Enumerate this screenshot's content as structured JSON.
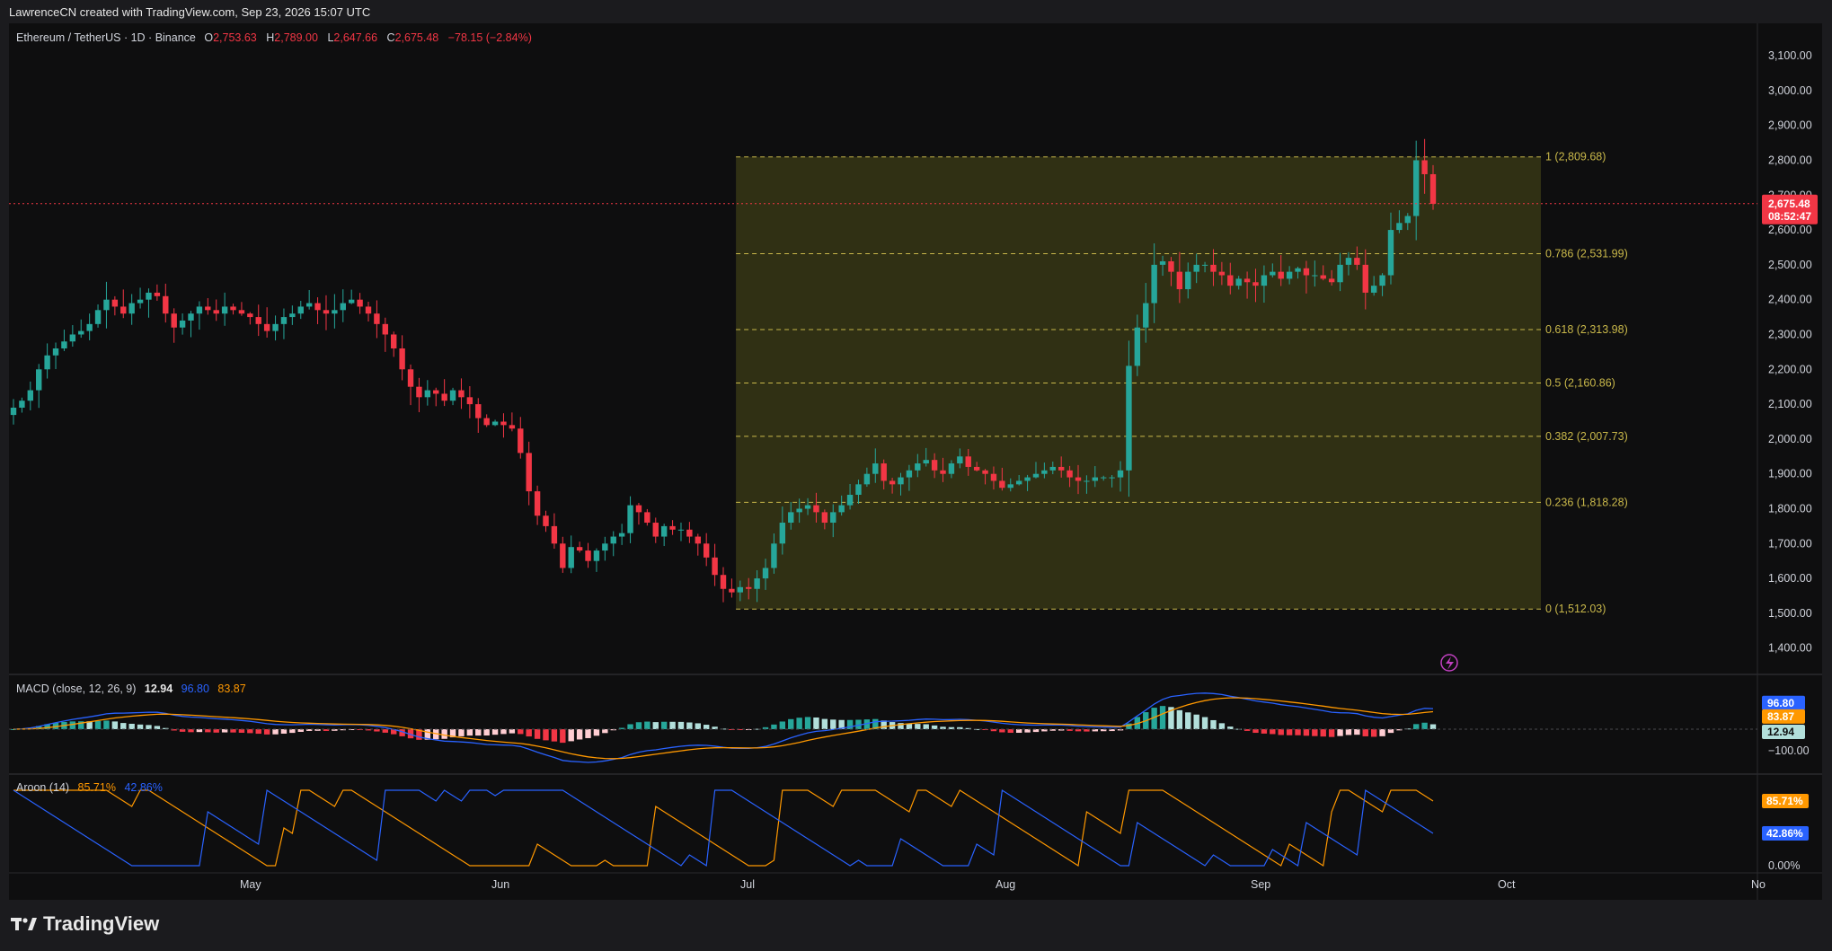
{
  "header": {
    "credit": "LawrenceCN created with TradingView.com, Sep 23, 2026 15:07 UTC"
  },
  "symbol": {
    "name": "Ethereum / TetherUS · 1D · Binance",
    "o_label": "O",
    "open": "2,753.63",
    "h_label": "H",
    "high": "2,789.00",
    "l_label": "L",
    "low": "2,647.66",
    "c_label": "C",
    "close": "2,675.48",
    "change": "−78.15 (−2.84%)"
  },
  "brand": {
    "name": "TradingView"
  },
  "colors": {
    "up": "#26a69a",
    "down": "#f23645",
    "fib": "#c9b84a",
    "macd": "#2962ff",
    "signal": "#ff9800"
  },
  "chart_data": [
    {
      "type": "candlestick",
      "title": "Ethereum / TetherUS · 1D · Binance",
      "x_ticks": [
        "May",
        "Jun",
        "Jul",
        "Aug",
        "Sep",
        "Oct",
        "No"
      ],
      "y_ticks": [
        "3,100.00",
        "3,000.00",
        "2,900.00",
        "2,800.00",
        "2,700.00",
        "2,600.00",
        "2,500.00",
        "2,400.00",
        "2,300.00",
        "2,200.00",
        "2,100.00",
        "2,000.00",
        "1,900.00",
        "1,800.00",
        "1,700.00",
        "1,600.00",
        "1,500.00",
        "1,400.00"
      ],
      "ylim": [
        1340,
        3180
      ],
      "last_price": "2,675.48",
      "countdown": "08:52:47",
      "fibonacci": {
        "levels": [
          {
            "label": "1 (2,809.68)",
            "value": 2809.68
          },
          {
            "label": "0.786 (2,531.99)",
            "value": 2531.99
          },
          {
            "label": "0.618 (2,313.98)",
            "value": 2313.98
          },
          {
            "label": "0.5 (2,160.86)",
            "value": 2160.86
          },
          {
            "label": "0.382 (2,007.73)",
            "value": 2007.73
          },
          {
            "label": "0.236 (1,818.28)",
            "value": 1818.28
          },
          {
            "label": "0 (1,512.03)",
            "value": 1512.03
          }
        ],
        "start_index": 86
      },
      "closes": [
        2090,
        2110,
        2140,
        2200,
        2240,
        2260,
        2280,
        2300,
        2310,
        2330,
        2370,
        2400,
        2380,
        2360,
        2390,
        2400,
        2420,
        2410,
        2360,
        2320,
        2340,
        2360,
        2380,
        2370,
        2360,
        2380,
        2370,
        2360,
        2350,
        2330,
        2310,
        2330,
        2350,
        2360,
        2380,
        2390,
        2370,
        2360,
        2370,
        2390,
        2400,
        2380,
        2360,
        2330,
        2300,
        2260,
        2200,
        2150,
        2120,
        2140,
        2130,
        2110,
        2140,
        2120,
        2100,
        2060,
        2040,
        2050,
        2040,
        2030,
        1960,
        1850,
        1780,
        1750,
        1700,
        1630,
        1690,
        1680,
        1650,
        1680,
        1700,
        1720,
        1730,
        1810,
        1790,
        1760,
        1720,
        1750,
        1740,
        1740,
        1720,
        1700,
        1660,
        1610,
        1570,
        1560,
        1575,
        1570,
        1600,
        1630,
        1700,
        1760,
        1790,
        1800,
        1810,
        1790,
        1760,
        1790,
        1810,
        1840,
        1870,
        1900,
        1930,
        1880,
        1870,
        1890,
        1910,
        1930,
        1940,
        1910,
        1900,
        1930,
        1950,
        1920,
        1910,
        1900,
        1880,
        1860,
        1870,
        1880,
        1890,
        1900,
        1910,
        1920,
        1910,
        1890,
        1880,
        1880,
        1890,
        1890,
        1890,
        1910,
        2210,
        2320,
        2390,
        2500,
        2510,
        2480,
        2430,
        2480,
        2500,
        2500,
        2480,
        2470,
        2440,
        2460,
        2450,
        2440,
        2470,
        2480,
        2460,
        2480,
        2490,
        2470,
        2470,
        2460,
        2450,
        2500,
        2520,
        2500,
        2420,
        2440,
        2470,
        2600,
        2620,
        2640,
        2800,
        2760,
        2675
      ],
      "volatility": 0.02
    },
    {
      "type": "line",
      "title": "MACD (close, 12, 26, 9)",
      "values_shown": [
        "12.94",
        "96.80",
        "83.87"
      ],
      "series": [
        {
          "name": "MACD",
          "color": "#2962ff"
        },
        {
          "name": "Signal",
          "color": "#ff9800"
        },
        {
          "name": "Histogram",
          "type": "bar"
        }
      ],
      "y_ticks": [
        "−100.00"
      ],
      "badges": [
        {
          "value": "96.80",
          "y": 96.8,
          "bg": "#2962ff"
        },
        {
          "value": "83.87",
          "y": 83.87,
          "bg": "#ff9800"
        },
        {
          "value": "12.94",
          "y": 12.94,
          "bg": "#b2dfdb"
        }
      ]
    },
    {
      "type": "line",
      "title": "Aroon (14)",
      "values_shown": [
        "85.71%",
        "42.86%"
      ],
      "series": [
        {
          "name": "Aroon Up",
          "color": "#ff9800",
          "last": 85.71
        },
        {
          "name": "Aroon Down",
          "color": "#2962ff",
          "last": 42.86
        }
      ],
      "y_ticks": [
        "0.00%"
      ],
      "badges": [
        {
          "value": "85.71%",
          "y": 85.71,
          "bg": "#ff9800"
        },
        {
          "value": "42.86%",
          "y": 42.86,
          "bg": "#2962ff"
        }
      ]
    }
  ]
}
